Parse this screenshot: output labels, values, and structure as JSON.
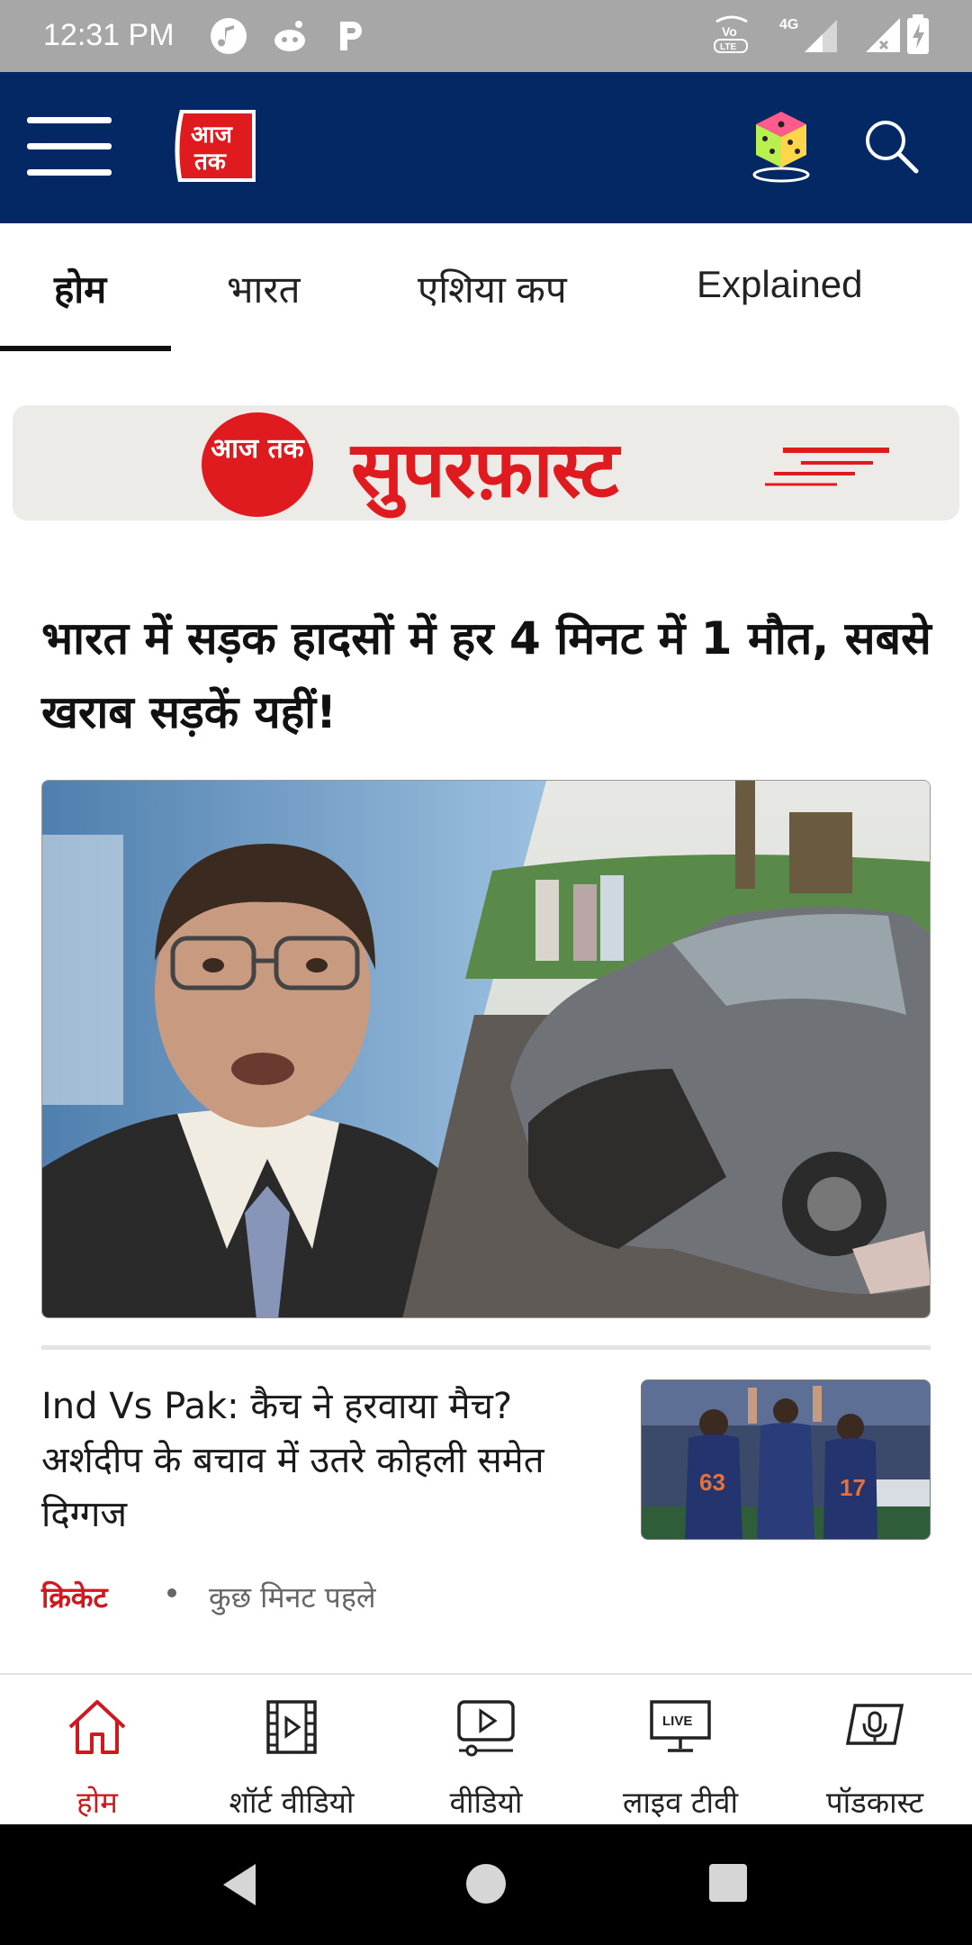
{
  "status_bar": {
    "time": "12:31 PM",
    "network": "4G",
    "volte": "VoLTE"
  },
  "header": {
    "logo_text": "आज तक",
    "icons": [
      "menu-icon",
      "dice-icon",
      "search-icon"
    ]
  },
  "tabs": [
    {
      "label": "होम",
      "active": true
    },
    {
      "label": "भारत",
      "active": false
    },
    {
      "label": "एशिया कप",
      "active": false
    },
    {
      "label": "Explained",
      "active": false
    }
  ],
  "banner": {
    "logo_text": "आज तक",
    "title": "सुपरफ़ास्ट"
  },
  "lead_story": {
    "headline": "भारत में सड़क हादसों में हर 4 मिनट में 1 मौत, सबसे खराब सड़कें यहीं!"
  },
  "story2": {
    "headline": "Ind Vs Pak: कैच ने हरवाया मैच? अर्शदीप के बचाव में उतरे कोहली समेत दिग्गज",
    "category": "क्रिकेट",
    "time": "कुछ मिनट पहले"
  },
  "bottom_nav": [
    {
      "label": "होम",
      "icon": "home-icon",
      "active": true
    },
    {
      "label": "शॉर्ट वीडियो",
      "icon": "film-icon",
      "active": false
    },
    {
      "label": "वीडियो",
      "icon": "video-play-icon",
      "active": false
    },
    {
      "label": "लाइव टीवी",
      "icon": "live-tv-icon",
      "active": false
    },
    {
      "label": "पॉडकास्ट",
      "icon": "podcast-icon",
      "active": false
    }
  ],
  "live_badge": "LIVE",
  "colors": {
    "header_bg": "#042863",
    "accent_red": "#d0191e",
    "status_bar_bg": "#a7a7a7"
  }
}
